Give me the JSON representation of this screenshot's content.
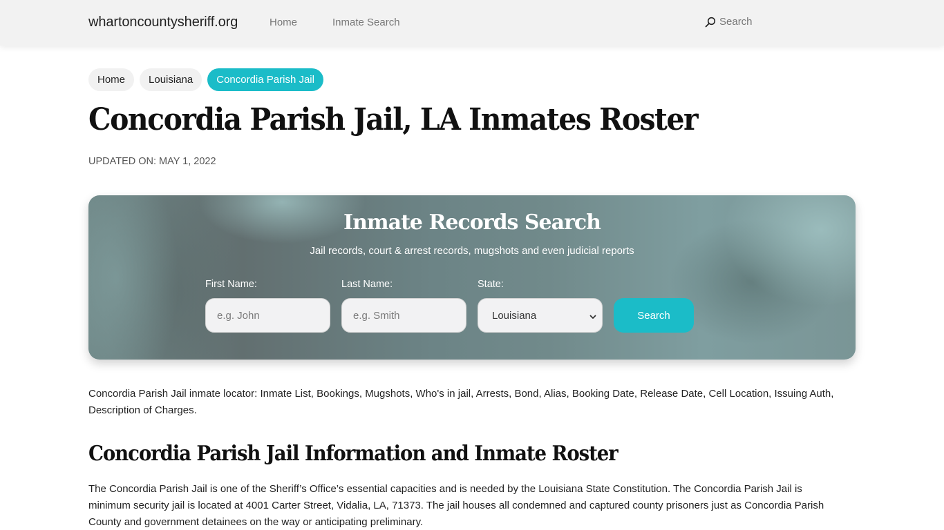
{
  "navbar": {
    "brand": "whartoncountysheriff.org",
    "links": [
      {
        "label": "Home"
      },
      {
        "label": "Inmate Search"
      }
    ],
    "search_label": "Search",
    "search_icon": "search-icon"
  },
  "breadcrumb": [
    {
      "label": "Home",
      "active": false
    },
    {
      "label": "Louisiana",
      "active": false
    },
    {
      "label": "Concordia Parish Jail",
      "active": true
    }
  ],
  "page": {
    "title": "Concordia Parish Jail, LA Inmates Roster",
    "updated": "UPDATED ON: MAY 1, 2022"
  },
  "search_banner": {
    "title": "Inmate Records Search",
    "subtitle": "Jail records, court & arrest records, mugshots and even judicial reports",
    "first_name": {
      "label": "First Name:",
      "placeholder": "e.g. John",
      "value": ""
    },
    "last_name": {
      "label": "Last Name:",
      "placeholder": "e.g. Smith",
      "value": ""
    },
    "state": {
      "label": "State:",
      "selected": "Louisiana"
    },
    "button_label": "Search"
  },
  "content": {
    "intro": "Concordia Parish Jail inmate locator: Inmate List, Bookings, Mugshots, Who's in jail, Arrests, Bond, Alias, Booking Date, Release Date, Cell Location, Issuing Auth, Description of Charges.",
    "section_title": "Concordia Parish Jail Information and Inmate Roster",
    "section_body": "The Concordia Parish Jail is one of the Sheriff’s Office’s essential capacities and is needed by the Louisiana State Constitution. The Concordia Parish Jail is minimum security jail is located at 4001 Carter Street, Vidalia, LA, 71373. The jail houses all condemned and captured county prisoners just as Concordia Parish County and government detainees on the way or anticipating preliminary."
  },
  "colors": {
    "accent": "#1bbcc8",
    "navbar_bg": "#f2f2f2",
    "crumb_bg": "#f1f1f1"
  }
}
